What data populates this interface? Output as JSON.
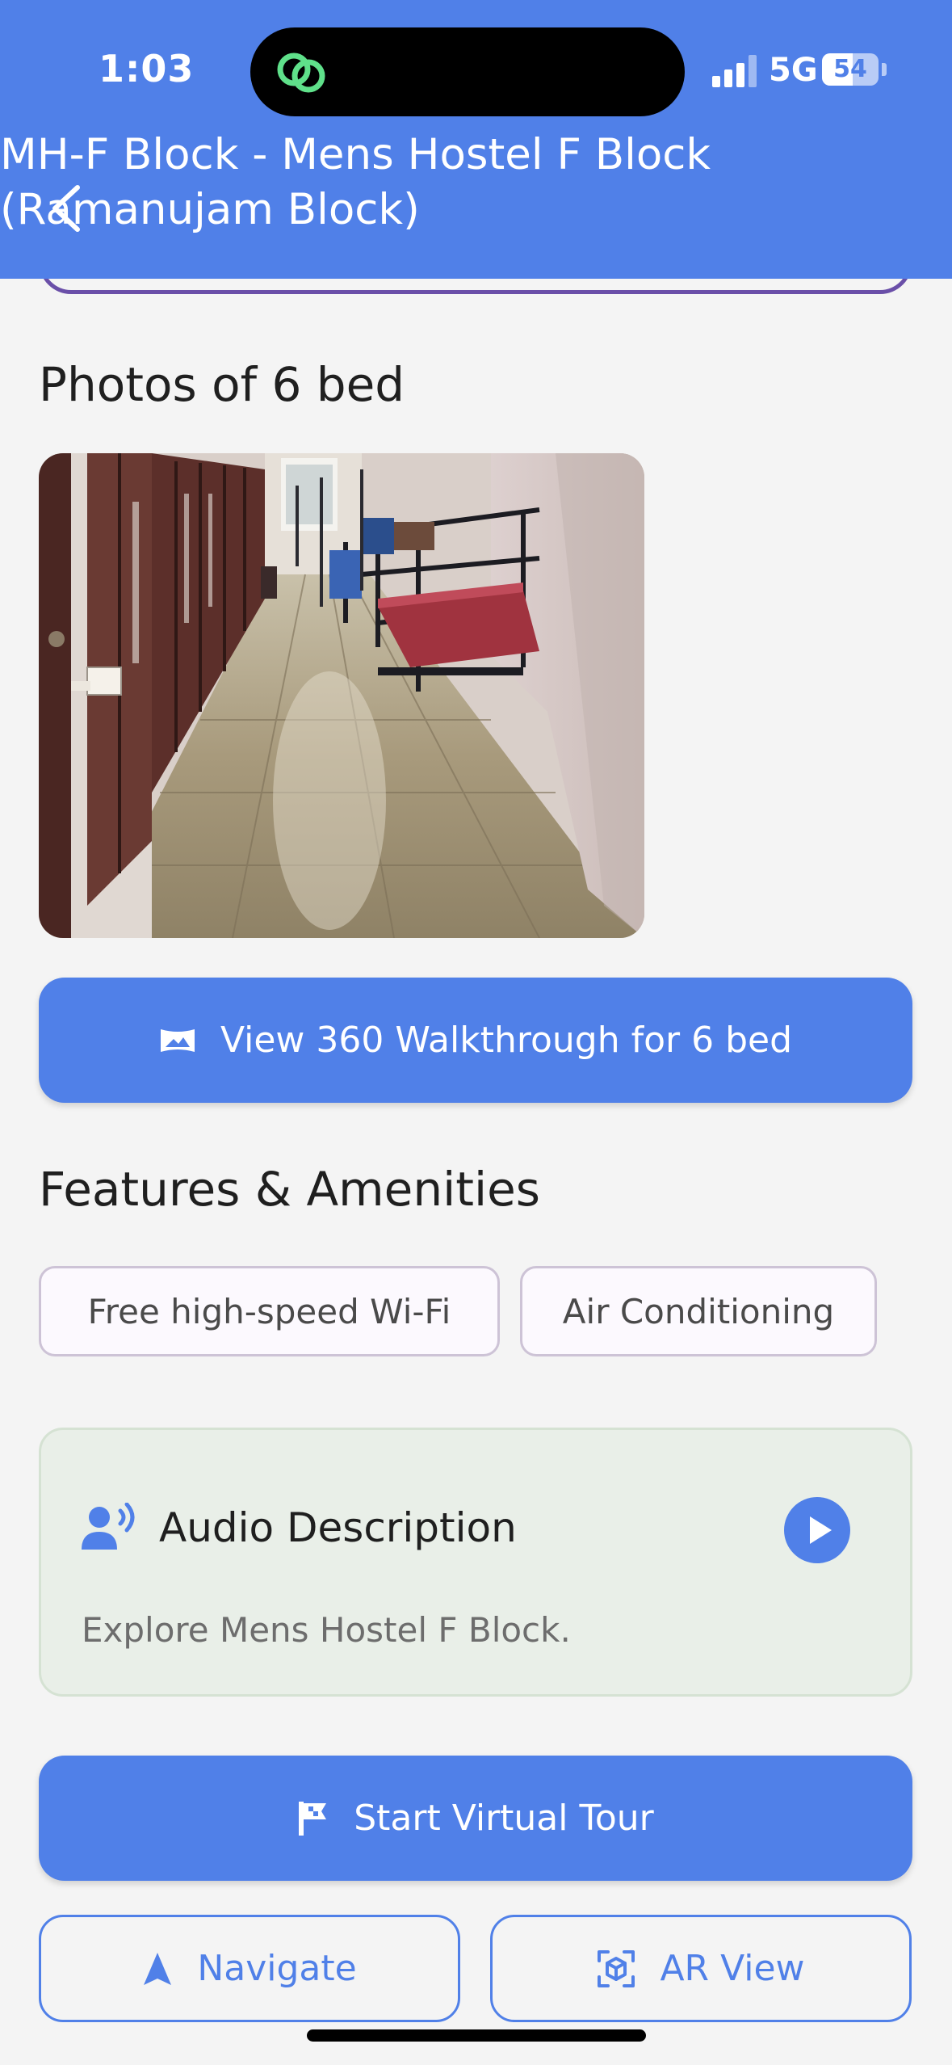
{
  "status_bar": {
    "time": "1:03",
    "network": "5G",
    "battery": "54",
    "battery_level_percent": 54
  },
  "header": {
    "title": "MH-F Block - Mens Hostel F Block (Ramanujam Block)",
    "back_icon": "chevron-left-icon"
  },
  "photos": {
    "title": "Photos of 6 bed"
  },
  "walkthrough_button": {
    "label": "View 360 Walkthrough for 6 bed",
    "icon": "panorama-icon"
  },
  "features": {
    "title": "Features & Amenities",
    "items": [
      "Free high-speed Wi-Fi",
      "Air Conditioning"
    ]
  },
  "audio": {
    "title": "Audio Description",
    "description": "Explore Mens Hostel F Block.",
    "icon": "speaking-person-icon",
    "play_icon": "play-icon"
  },
  "actions": {
    "start_tour": "Start Virtual Tour",
    "navigate": "Navigate",
    "ar_view": "AR View"
  },
  "colors": {
    "primary": "#5080e8",
    "background": "#f4f4f4",
    "audio_card": "#e9efe8"
  }
}
